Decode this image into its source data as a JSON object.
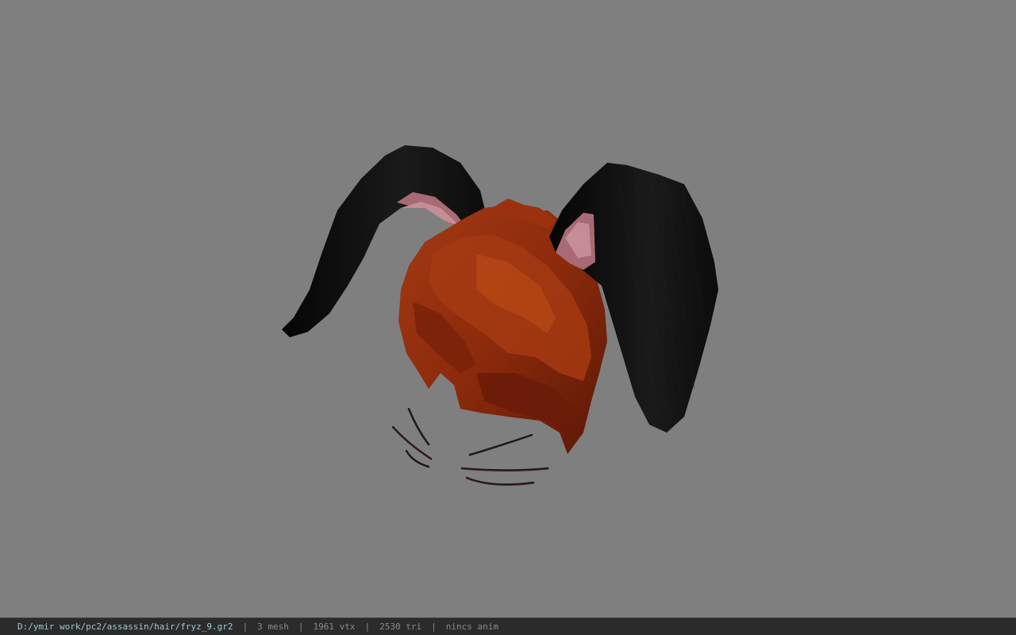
{
  "viewport": {
    "background_color": "#7f7f7f",
    "model": {
      "hair_color": "#8c2a0c",
      "ear_color": "#111111",
      "inner_ear_color": "#b0707c",
      "whisker_color": "#1a1a1a"
    }
  },
  "status_bar": {
    "file_path": "D:/ymir work/pc2/assassin/hair/fryz_9.gr2",
    "separator": "|",
    "mesh_count": "3 mesh",
    "vertex_count": "1961 vtx",
    "triangle_count": "2530 tri",
    "anim_status": "nincs anim"
  }
}
